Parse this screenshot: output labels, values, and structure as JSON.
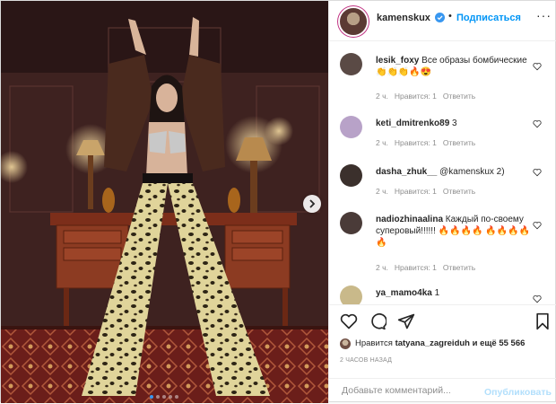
{
  "header": {
    "username": "kamenskux",
    "separator": "•",
    "follow_label": "Подписаться",
    "more_label": "···"
  },
  "comments": [
    {
      "username": "lesik_foxy",
      "text": "Все образы бомбические👏👏👏🔥😍",
      "time": "2 ч.",
      "likes": "Нравится: 1",
      "reply": "Ответить",
      "avatar_color": "#5a4a45"
    },
    {
      "username": "keti_dmitrenko89",
      "text": "3",
      "time": "2 ч.",
      "likes": "Нравится: 1",
      "reply": "Ответить",
      "avatar_color": "#b8a2c8"
    },
    {
      "username": "dasha_zhuk__",
      "text": "@kamenskux 2)",
      "time": "2 ч.",
      "likes": "Нравится: 1",
      "reply": "Ответить",
      "avatar_color": "#3b302c"
    },
    {
      "username": "nadiozhinaalina",
      "text": "Каждый по-своему суперовый!!!!!! 🔥🔥🔥🔥 🔥🔥🔥🔥🔥",
      "time": "2 ч.",
      "likes": "Нравится: 1",
      "reply": "Ответить",
      "avatar_color": "#4a3b38"
    },
    {
      "username": "ya_mamo4ka",
      "text": "1",
      "avatar_color": "#c9b98a"
    }
  ],
  "likes": {
    "prefix": "Нравится",
    "user": "tatyana_zagreiduh",
    "suffix": "и ещё 55 566"
  },
  "time_ago": "2 ЧАСОВ НАЗАД",
  "add_comment": {
    "placeholder": "Добавьте комментарий...",
    "publish_label": "Опубликовать"
  },
  "carousel": {
    "total": 5,
    "active_index": 0
  },
  "colors": {
    "link_blue": "#0095f6",
    "disabled_blue": "#b2dffc",
    "meta_gray": "#8e8e8e"
  }
}
